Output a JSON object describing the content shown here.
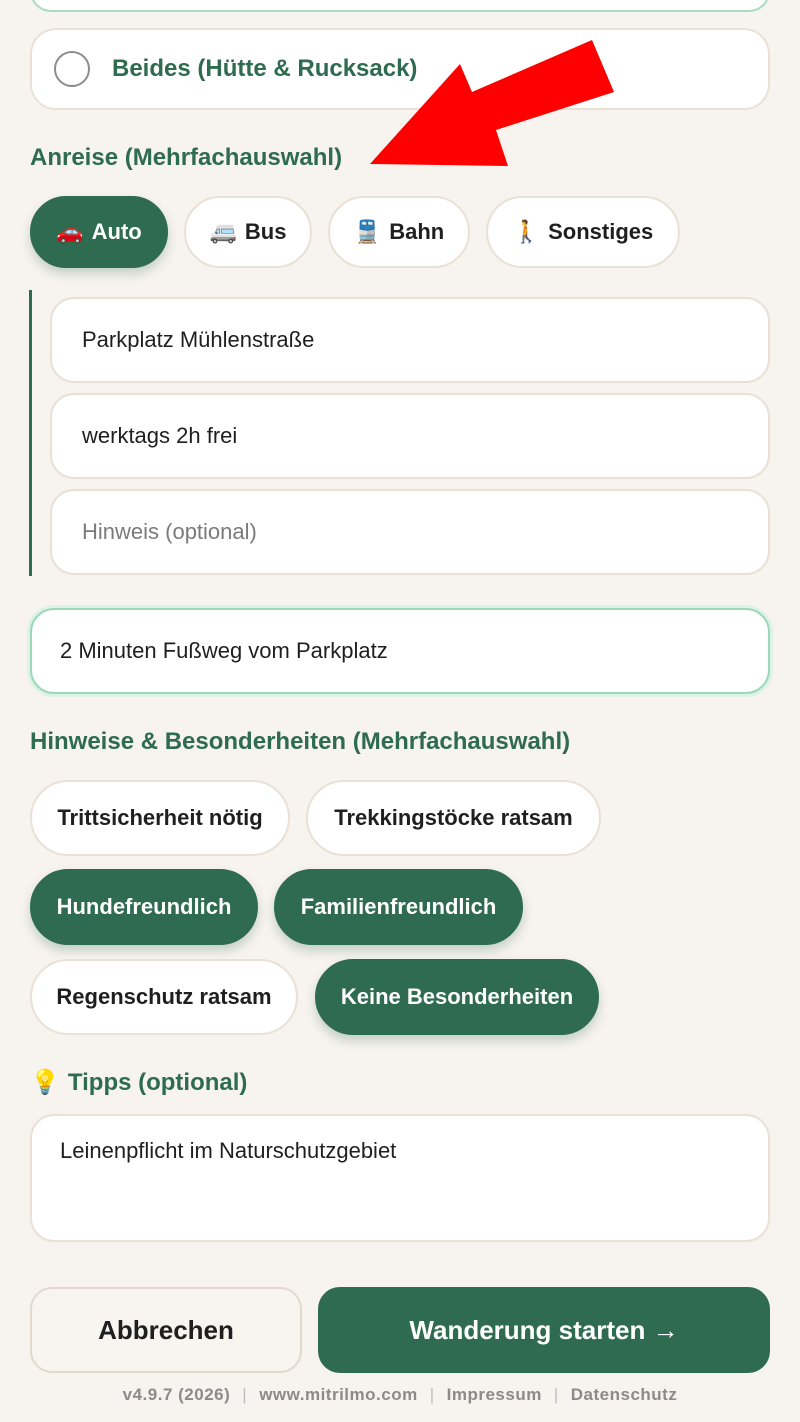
{
  "radio_option": {
    "label": "Beides (Hütte & Rucksack)"
  },
  "anreise": {
    "title": "Anreise (Mehrfachauswahl)",
    "options": [
      {
        "emoji": "🚗",
        "label": "Auto",
        "selected": true
      },
      {
        "emoji": "🚐",
        "label": "Bus",
        "selected": false
      },
      {
        "emoji": "🚆",
        "label": "Bahn",
        "selected": false
      },
      {
        "emoji": "🚶",
        "label": "Sonstiges",
        "selected": false
      }
    ],
    "auto_fields": {
      "parking_name": "Parkplatz Mühlenstraße",
      "parking_cost": "werktags 2h frei",
      "note_placeholder": "Hinweis (optional)"
    },
    "walk_distance": "2 Minuten Fußweg vom Parkplatz"
  },
  "hinweise": {
    "title": "Hinweise & Besonderheiten (Mehrfachauswahl)",
    "options": [
      {
        "label": "Trittsicherheit nötig",
        "selected": false
      },
      {
        "label": "Trekkingstöcke ratsam",
        "selected": false
      },
      {
        "label": "Hundefreundlich",
        "selected": true
      },
      {
        "label": "Familienfreundlich",
        "selected": true
      },
      {
        "label": "Regenschutz ratsam",
        "selected": false
      },
      {
        "label": "Keine Besonderheiten",
        "selected": true
      }
    ]
  },
  "tipps": {
    "icon": "lightbulb-icon",
    "emoji": "💡",
    "title": "Tipps (optional)",
    "value": "Leinenpflicht im Naturschutzgebiet"
  },
  "actions": {
    "cancel_label": "Abbrechen",
    "start_label": "Wanderung starten →"
  },
  "footer": {
    "version": "v4.9.7 (2026)",
    "website": "www.mitrilmo.com",
    "impressum": "Impressum",
    "datenschutz": "Datenschutz"
  },
  "colors": {
    "accent": "#2e6b51",
    "background": "#f7f3ee",
    "annotation_arrow": "#ff0000"
  }
}
